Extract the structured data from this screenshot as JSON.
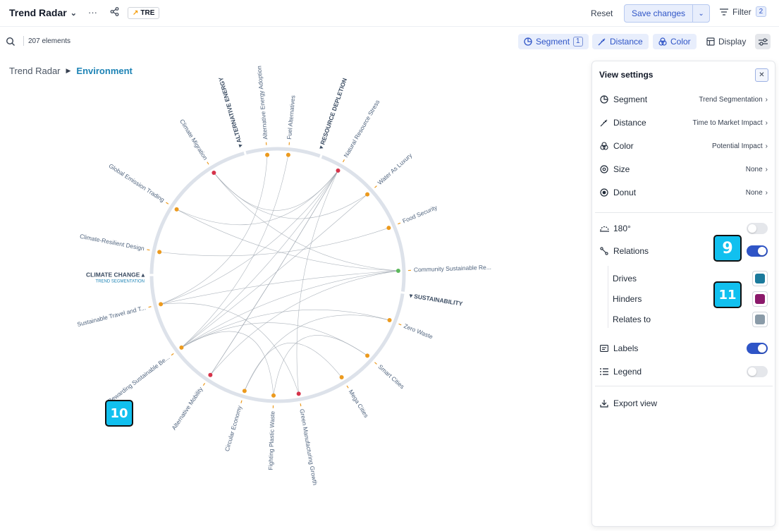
{
  "header": {
    "title": "Trend Radar",
    "tag_label": "TRE",
    "reset_label": "Reset",
    "save_label": "Save changes",
    "filter_label": "Filter",
    "filter_count": "2"
  },
  "subbar": {
    "elements_count": "207 elements",
    "segment_label": "Segment",
    "segment_count": "1",
    "distance_label": "Distance",
    "color_label": "Color",
    "display_label": "Display"
  },
  "breadcrumb": {
    "root": "Trend Radar",
    "current": "Environment"
  },
  "radar": {
    "segments": [
      {
        "name": "ALTERNATIVE ENERGY"
      },
      {
        "name": "RESOURCE DEPLETION"
      },
      {
        "name": "SUSTAINABILITY"
      },
      {
        "name": "CLIMATE CHANGE",
        "subtitle": "TREND SEGMENTATION"
      }
    ],
    "trends": [
      {
        "label": "Alternative Energy Adoption",
        "color": "#ec9a1e"
      },
      {
        "label": "Fuel Alternatives",
        "color": "#ec9a1e"
      },
      {
        "label": "Natural Resource Stress",
        "color": "#d6334a"
      },
      {
        "label": "Water As Luxury",
        "color": "#ec9a1e"
      },
      {
        "label": "Food Security",
        "color": "#ec9a1e"
      },
      {
        "label": "Community Sustainable Re...",
        "color": "#5cb85c"
      },
      {
        "label": "Zero Waste",
        "color": "#ec9a1e"
      },
      {
        "label": "Smart Cities",
        "color": "#ec9a1e"
      },
      {
        "label": "Mega Cities",
        "color": "#ec9a1e"
      },
      {
        "label": "Green Manufacturing Growth",
        "color": "#d6334a"
      },
      {
        "label": "Fighting Plastic Waste",
        "color": "#ec9a1e"
      },
      {
        "label": "Circular Economy",
        "color": "#ec9a1e"
      },
      {
        "label": "Alternative Mobility",
        "color": "#d6334a"
      },
      {
        "label": "Rewarding Sustainable Be...",
        "color": "#ec9a1e"
      },
      {
        "label": "Sustainable Travel and T...",
        "color": "#ec9a1e"
      },
      {
        "label": "Climate-Resilient Design",
        "color": "#ec9a1e"
      },
      {
        "label": "Global Emission Trading",
        "color": "#ec9a1e"
      },
      {
        "label": "Climate Migration",
        "color": "#d6334a"
      }
    ]
  },
  "panel": {
    "title": "View settings",
    "segment_label": "Segment",
    "segment_value": "Trend Segmentation",
    "distance_label": "Distance",
    "distance_value": "Time to Market Impact",
    "color_label": "Color",
    "color_value": "Potential Impact",
    "size_label": "Size",
    "size_value": "None",
    "donut_label": "Donut",
    "donut_value": "None",
    "rotate_label": "180°",
    "rotate_on": false,
    "relations_label": "Relations",
    "relations_on": true,
    "drives_label": "Drives",
    "drives_color": "#1b7a9c",
    "hinders_label": "Hinders",
    "hinders_color": "#8b1a6b",
    "relates_label": "Relates to",
    "relates_color": "#8a9ba8",
    "labels_label": "Labels",
    "labels_on": true,
    "legend_label": "Legend",
    "legend_on": false,
    "export_label": "Export view"
  },
  "callouts": [
    "9",
    "10",
    "11"
  ]
}
